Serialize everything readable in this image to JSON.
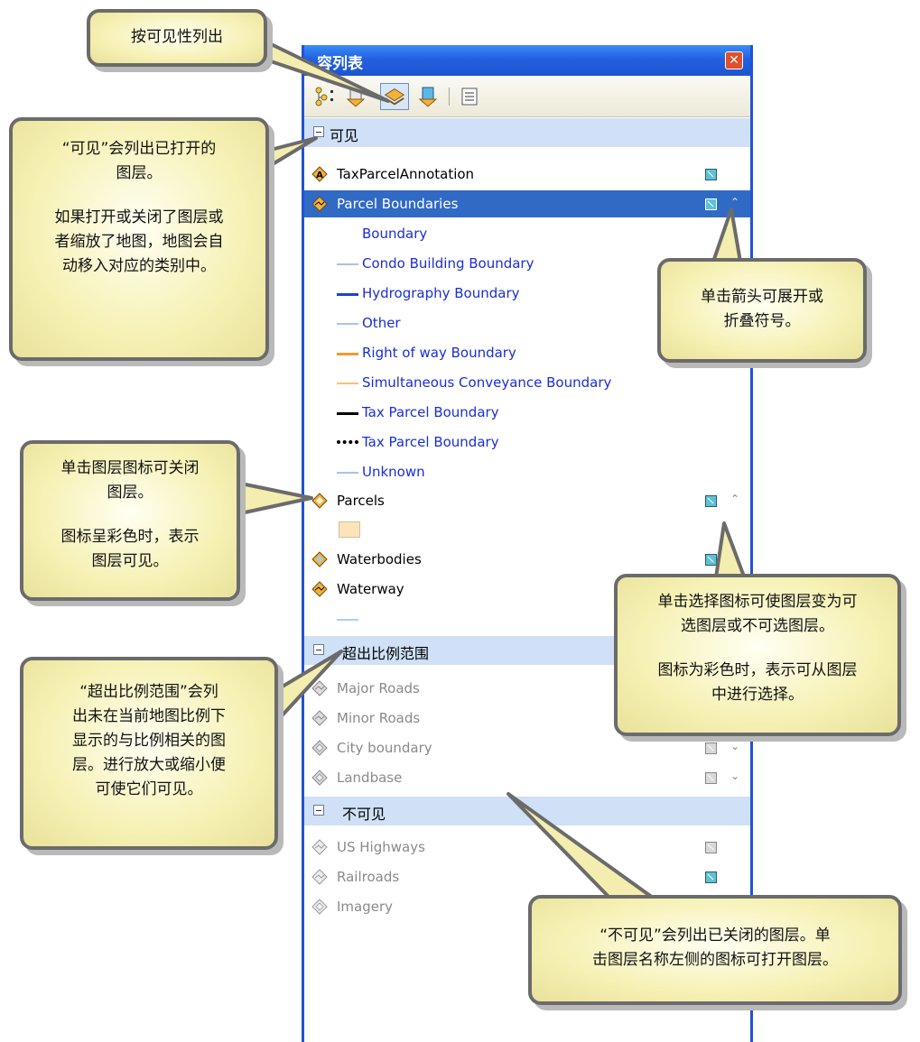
{
  "window": {
    "title": "容列表",
    "close_glyph": "✕"
  },
  "toolbar": {
    "buttons": [
      {
        "name": "list-by-drawing-order-icon"
      },
      {
        "name": "list-by-source-icon"
      },
      {
        "name": "list-by-visibility-icon",
        "selected": true
      },
      {
        "name": "list-by-selection-icon"
      },
      {
        "name": "options-icon"
      }
    ]
  },
  "groups": {
    "visible": {
      "label": "可见"
    },
    "out_of_scale": {
      "label": "超出比例范围"
    },
    "not_visible": {
      "label": "不可见"
    }
  },
  "layers": {
    "tax_annotation": "TaxParcelAnnotation",
    "parcel_boundaries": "Parcel Boundaries",
    "parcels": "Parcels",
    "waterbodies": "Waterbodies",
    "waterway": "Waterway",
    "major_roads": "Major Roads",
    "minor_roads": "Minor Roads",
    "city_boundary": "City boundary",
    "landbase": "Landbase",
    "us_highways": "US Highways",
    "railroads": "Railroads",
    "imagery": "Imagery"
  },
  "legend": [
    {
      "label": "Boundary",
      "color": "none"
    },
    {
      "label": "Condo Building Boundary",
      "color": "#a9c1ee"
    },
    {
      "label": "Hydrography Boundary",
      "color": "#1f3fd8"
    },
    {
      "label": "Other",
      "color": "#a9c1ee"
    },
    {
      "label": "Right of way Boundary",
      "color": "#f39a2c"
    },
    {
      "label": "Simultaneous Conveyance Boundary",
      "color": "#f6c17a"
    },
    {
      "label": "Tax Parcel Boundary",
      "color": "#000000"
    },
    {
      "label": "Tax Parcel Boundary",
      "color": "dotted"
    },
    {
      "label": "Unknown",
      "color": "#a9c1ee"
    }
  ],
  "callouts": {
    "visibility": "按可见性列出",
    "visible_1": "“可见”会列出已打开的",
    "visible_2": "图层。",
    "visible_3": "如果打开或关闭了图层或",
    "visible_4": "者缩放了地图，地图会自",
    "visible_5": "动移入对应的类别中。",
    "expand_1": "单击箭头可展开或",
    "expand_2": "折叠符号。",
    "layer_icon_1": "单击图层图标可关闭",
    "layer_icon_2": "图层。",
    "layer_icon_3": "图标呈彩色时，表示",
    "layer_icon_4": "图层可见。",
    "select_1": "单击选择图标可使图层变为可",
    "select_2": "选图层或不可选图层。",
    "select_3": "图标为彩色时，表示可从图层",
    "select_4": "中进行选择。",
    "scale_1": "“超出比例范围”会列",
    "scale_2": "出未在当前地图比例下",
    "scale_3": "显示的与比例相关的图",
    "scale_4": "层。进行放大或缩小便",
    "scale_5": "可使它们可见。",
    "hidden_1": "“不可见”会列出已关闭的图层。单",
    "hidden_2": "击图层名称左侧的图标可打开图层。"
  },
  "colors": {
    "title_bar": "#2260e0",
    "group_header": "#cfe0f7",
    "selection": "#316ac5",
    "callout": "#f6f1b4"
  }
}
